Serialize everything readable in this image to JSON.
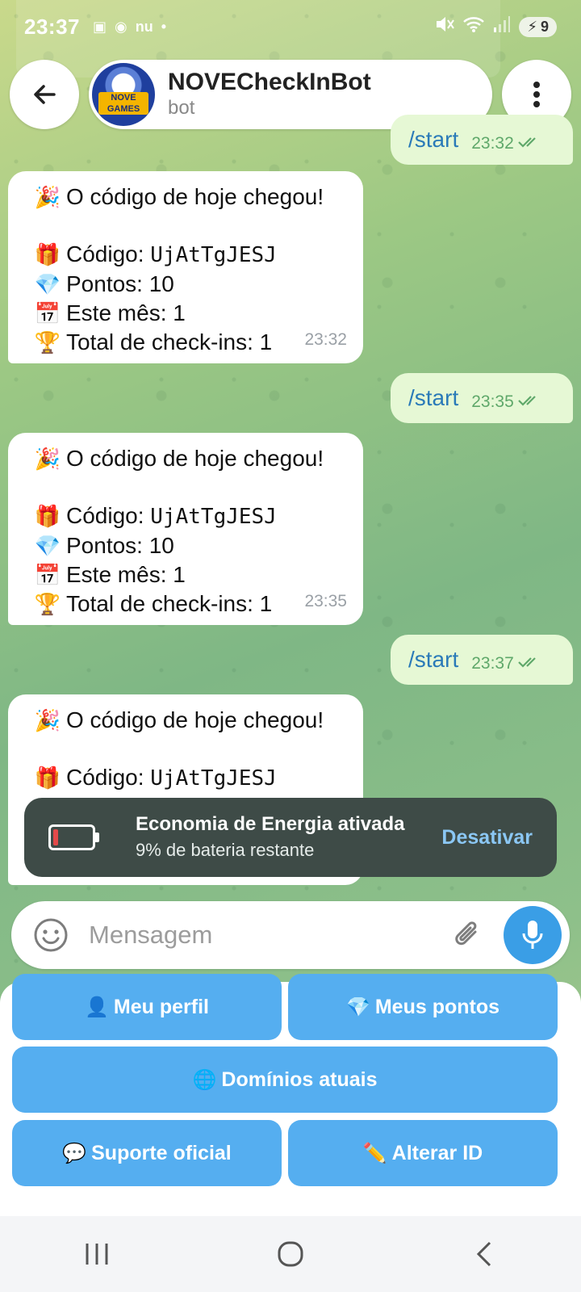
{
  "status_bar": {
    "time": "23:37",
    "left_icons": [
      "chip-icon",
      "shield-icon",
      "nu-icon",
      "dot-icon"
    ],
    "nu_label": "nu",
    "battery_level": "9"
  },
  "header": {
    "title": "NOVECheckInBot",
    "subtitle": "bot",
    "avatar_text": "NOVE GAMES"
  },
  "messages": [
    {
      "type": "outgoing",
      "text": "/start",
      "time": "23:32",
      "status": "read"
    },
    {
      "type": "incoming",
      "headline": "O código de hoje chegou!",
      "code_label": "Código: ",
      "code_value": "UjAtTgJESJ",
      "points": "Pontos: 10",
      "month": "Este mês: 1",
      "total": "Total de check-ins: 1",
      "time": "23:32"
    },
    {
      "type": "outgoing",
      "text": "/start",
      "time": "23:35",
      "status": "read"
    },
    {
      "type": "incoming",
      "headline": "O código de hoje chegou!",
      "code_label": "Código: ",
      "code_value": "UjAtTgJESJ",
      "points": "Pontos: 10",
      "month": "Este mês: 1",
      "total": "Total de check-ins: 1",
      "time": "23:35"
    },
    {
      "type": "outgoing",
      "text": "/start",
      "time": "23:37",
      "status": "read"
    },
    {
      "type": "incoming",
      "headline": "O código de hoje chegou!",
      "code_label": "Código: ",
      "code_value": "UjAtTgJESJ"
    }
  ],
  "toast": {
    "title": "Economia de Energia ativada",
    "subtitle": "9% de bateria restante",
    "action": "Desativar"
  },
  "input": {
    "placeholder": "Mensagem"
  },
  "keyboard": {
    "buttons": [
      {
        "icon": "👤",
        "label": "Meu perfil"
      },
      {
        "icon": "💎",
        "label": "Meus pontos"
      },
      {
        "icon": "🌐",
        "label": "Domínios atuais"
      },
      {
        "icon": "💬",
        "label": "Suporte oficial"
      },
      {
        "icon": "✏️",
        "label": "Alterar ID"
      }
    ]
  },
  "emojis": {
    "party": "🎉",
    "gift": "🎁",
    "diamond": "💎",
    "calendar": "📅",
    "trophy": "🏆"
  },
  "colors": {
    "accent": "#55aef0",
    "outgoing_bubble": "#e6f8d5",
    "toast_bg": "#3e4b47",
    "toast_action": "#8bc7f4"
  }
}
